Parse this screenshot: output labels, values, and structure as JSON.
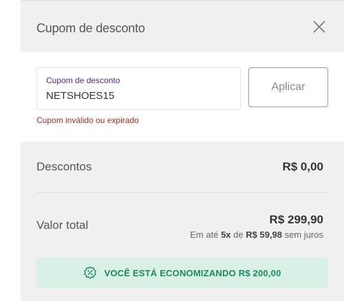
{
  "coupon": {
    "title": "Cupom de desconto",
    "field_label": "Cupom de desconto",
    "field_value": "NETSHOES15",
    "apply_label": "Aplicar",
    "error": "Cupom inválido ou expirado",
    "close_icon": "close-icon"
  },
  "summary": {
    "discounts_label": "Descontos",
    "discounts_value": "R$ 0,00",
    "total_label": "Valor total",
    "total_value": "R$ 299,90",
    "installments_prefix": "Em até",
    "installments_count": "5x",
    "installments_of": "de",
    "installments_value": "R$ 59,98",
    "installments_suffix": "sem juros"
  },
  "savings": {
    "icon": "discount-badge-icon",
    "text": "VOCÊ ESTÁ ECONOMIZANDO R$ 200,00"
  },
  "colors": {
    "accent_purple": "#5a1f8a",
    "error_red": "#b3261e",
    "savings_green": "#1d8a5a",
    "savings_bg": "#d9f0e6"
  }
}
